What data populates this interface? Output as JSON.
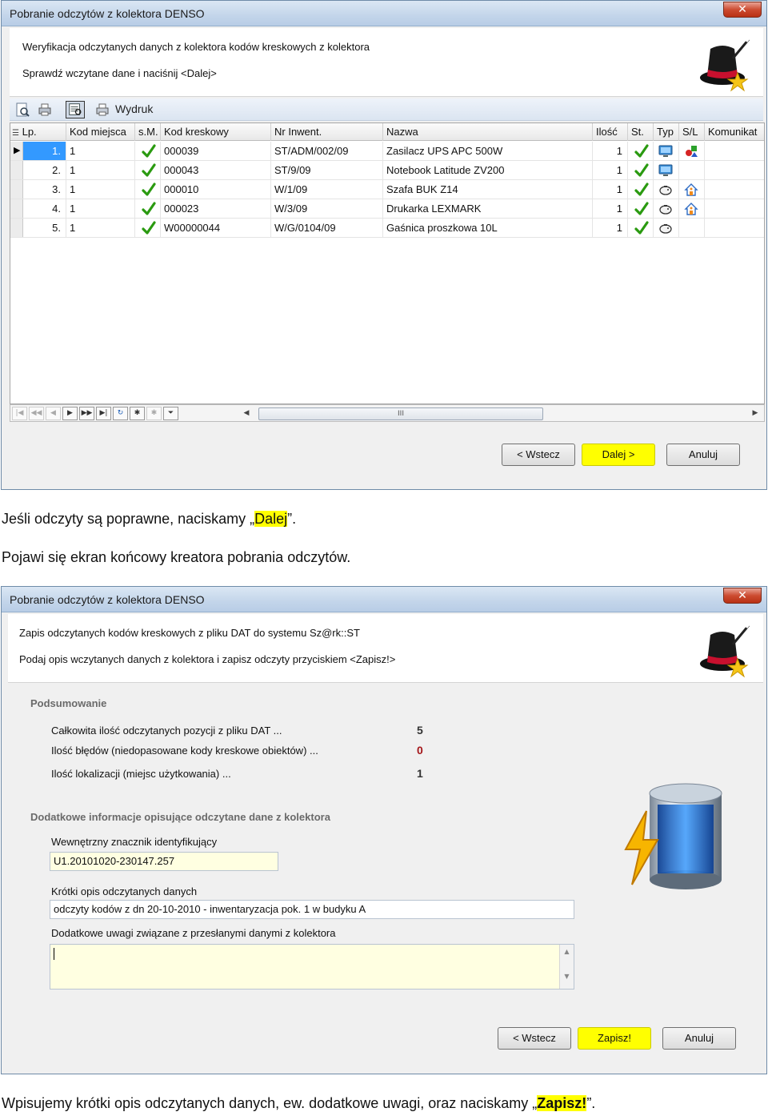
{
  "window1": {
    "title": "Pobranie odczytów z kolektora DENSO",
    "header_line1": "Weryfikacja odczytanych danych z kolektora kodów kreskowych z kolektora",
    "header_line2": "Sprawdź wczytane dane i naciśnij <Dalej>",
    "toolbar": {
      "print_label": "Wydruk"
    },
    "grid": {
      "columns": [
        "Lp.",
        "Kod miejsca",
        "s.M.",
        "Kod kreskowy",
        "Nr Inwent.",
        "Nazwa",
        "Ilość",
        "St.",
        "Typ",
        "S/L",
        "Komunikat"
      ],
      "rows": [
        {
          "lp": "1.",
          "kod_miejsca": "1",
          "kod_kreskowy": "000039",
          "nr_inwent": "ST/ADM/002/09",
          "nazwa": "Zasilacz UPS APC 500W",
          "ilosc": "1",
          "typ_icon": "monitor-icon",
          "sl_icon": "shapes-icon"
        },
        {
          "lp": "2.",
          "kod_miejsca": "1",
          "kod_kreskowy": "000043",
          "nr_inwent": "ST/9/09",
          "nazwa": "Notebook Latitude ZV200",
          "ilosc": "1",
          "typ_icon": "monitor-icon",
          "sl_icon": ""
        },
        {
          "lp": "3.",
          "kod_miejsca": "1",
          "kod_kreskowy": "000010",
          "nr_inwent": "W/1/09",
          "nazwa": "Szafa BUK Z14",
          "ilosc": "1",
          "typ_icon": "piggy-bank-icon",
          "sl_icon": "house-icon"
        },
        {
          "lp": "4.",
          "kod_miejsca": "1",
          "kod_kreskowy": "000023",
          "nr_inwent": "W/3/09",
          "nazwa": "Drukarka LEXMARK",
          "ilosc": "1",
          "typ_icon": "piggy-bank-icon",
          "sl_icon": "house-icon"
        },
        {
          "lp": "5.",
          "kod_miejsca": "1",
          "kod_kreskowy": "W00000044",
          "nr_inwent": "W/G/0104/09",
          "nazwa": "Gaśnica proszkowa 10L",
          "ilosc": "1",
          "typ_icon": "piggy-bank-icon",
          "sl_icon": ""
        }
      ]
    },
    "scroll_thumb_label": "III",
    "buttons": {
      "back": "< Wstecz",
      "next": "Dalej >",
      "cancel": "Anuluj"
    }
  },
  "caption1": {
    "prefix": "Jeśli odczyty są poprawne, naciskamy „",
    "highlight": "Dalej",
    "suffix": "”."
  },
  "caption2": "Pojawi się ekran końcowy kreatora pobrania odczytów.",
  "window2": {
    "title": "Pobranie odczytów z kolektora DENSO",
    "header_line1": "Zapis odczytanych kodów kreskowych z pliku DAT do systemu Sz@rk::ST",
    "header_line2": "Podaj opis wczytanych danych z kolektora i zapisz odczyty przyciskiem <Zapisz!>",
    "summary": {
      "title": "Podsumowanie",
      "items": [
        {
          "label": "Całkowita ilość odczytanych pozycji z pliku DAT    ...",
          "value": "5"
        },
        {
          "label": "Ilość błędów (niedopasowane kody kreskowe obiektów)  ...",
          "value": "0"
        },
        {
          "label": "Ilość lokalizacji (miejsc użytkowania)  ...",
          "value": "1"
        }
      ]
    },
    "extra": {
      "title": "Dodatkowe informacje opisujące odczytane dane z kolektora",
      "id_label": "Wewnętrzny znacznik identyfikujący",
      "id_value": "U1.20101020-230147.257",
      "desc_label": "Krótki opis odczytanych danych",
      "desc_value": "odczyty kodów z dn 20-10-2010 - inwentaryzacja pok. 1 w budyku A",
      "notes_label": "Dodatkowe uwagi związane z przesłanymi danymi z kolektora",
      "notes_value": ""
    },
    "buttons": {
      "back": "< Wstecz",
      "save": "Zapisz!",
      "cancel": "Anuluj"
    }
  },
  "caption3": {
    "prefix": "Wpisujemy krótki opis  odczytanych danych, ew. dodatkowe uwagi, oraz naciskamy „",
    "highlight": "Zapisz!",
    "suffix": "”."
  },
  "colors": {
    "highlight": "#ffff00",
    "selection": "#3399ff",
    "error": "#a4161a"
  }
}
